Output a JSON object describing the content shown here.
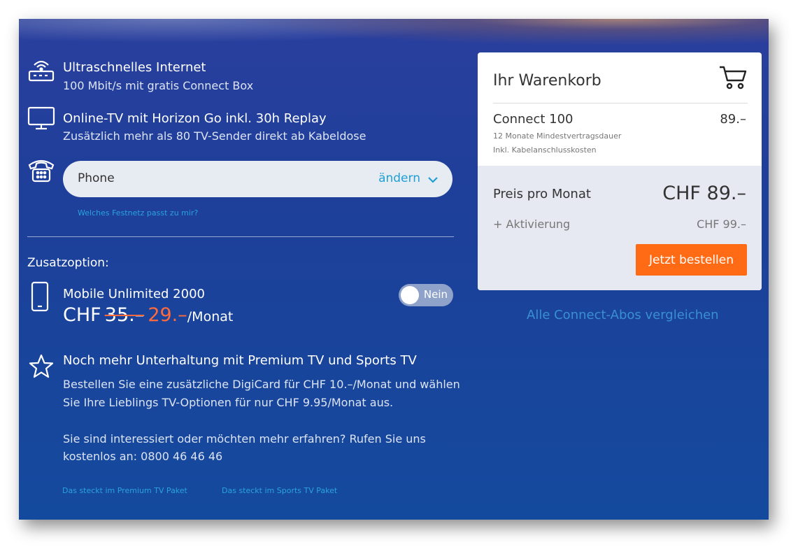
{
  "features": [
    {
      "title": "Ultraschnelles Internet",
      "subtitle": "100 Mbit/s mit gratis Connect Box",
      "icon": "router-icon"
    },
    {
      "title": "Online-TV mit Horizon Go inkl. 30h Replay",
      "subtitle": "Zusätzlich mehr als 80 TV-Sender direkt ab Kabeldose",
      "icon": "tv-monitor-icon"
    }
  ],
  "phone": {
    "icon": "telephone-icon",
    "value": "Phone",
    "change_label": "ändern",
    "help_link": "Welches Festnetz passt zu mir?"
  },
  "addon": {
    "heading": "Zusatzoption:",
    "name": "Mobile Unlimited 2000",
    "currency": "CHF",
    "old_price": "35.–",
    "new_price": "29.–",
    "per": "/Monat",
    "toggle_label": "Nein",
    "toggle_on": false,
    "icon": "smartphone-icon"
  },
  "premium": {
    "title": "Noch mehr Unterhaltung mit Premium TV und Sports TV",
    "text1": "Bestellen Sie eine zusätzliche DigiCard für CHF 10.–/Monat und wählen",
    "text2": "Sie Ihre Lieblings TV-Optionen für nur CHF 9.95/Monat aus.",
    "text3": "Sie sind interessiert oder möchten mehr erfahren? Rufen Sie uns",
    "text4": "kostenlos an: 0800 46 46 46",
    "link1": "Das steckt im Premium TV Paket",
    "link2": "Das steckt im Sports TV Paket",
    "icon": "star-icon"
  },
  "cart": {
    "title": "Ihr Warenkorb",
    "item_name": "Connect 100",
    "item_price": "89.–",
    "detail1": "12 Monate Mindestvertragsdauer",
    "detail2": "Inkl. Kabelanschlusskosten",
    "monthly_label": "Preis pro Monat",
    "monthly_value": "CHF 89.–",
    "activation_label": "+ Aktivierung",
    "activation_value": "CHF 99.–",
    "order_button": "Jetzt bestellen"
  },
  "compare_link": "Alle Connect-Abos vergleichen",
  "colors": {
    "accent_orange": "#ff6b14",
    "link_blue": "#2aa3dc",
    "background_blue": "#1e3f9a"
  }
}
